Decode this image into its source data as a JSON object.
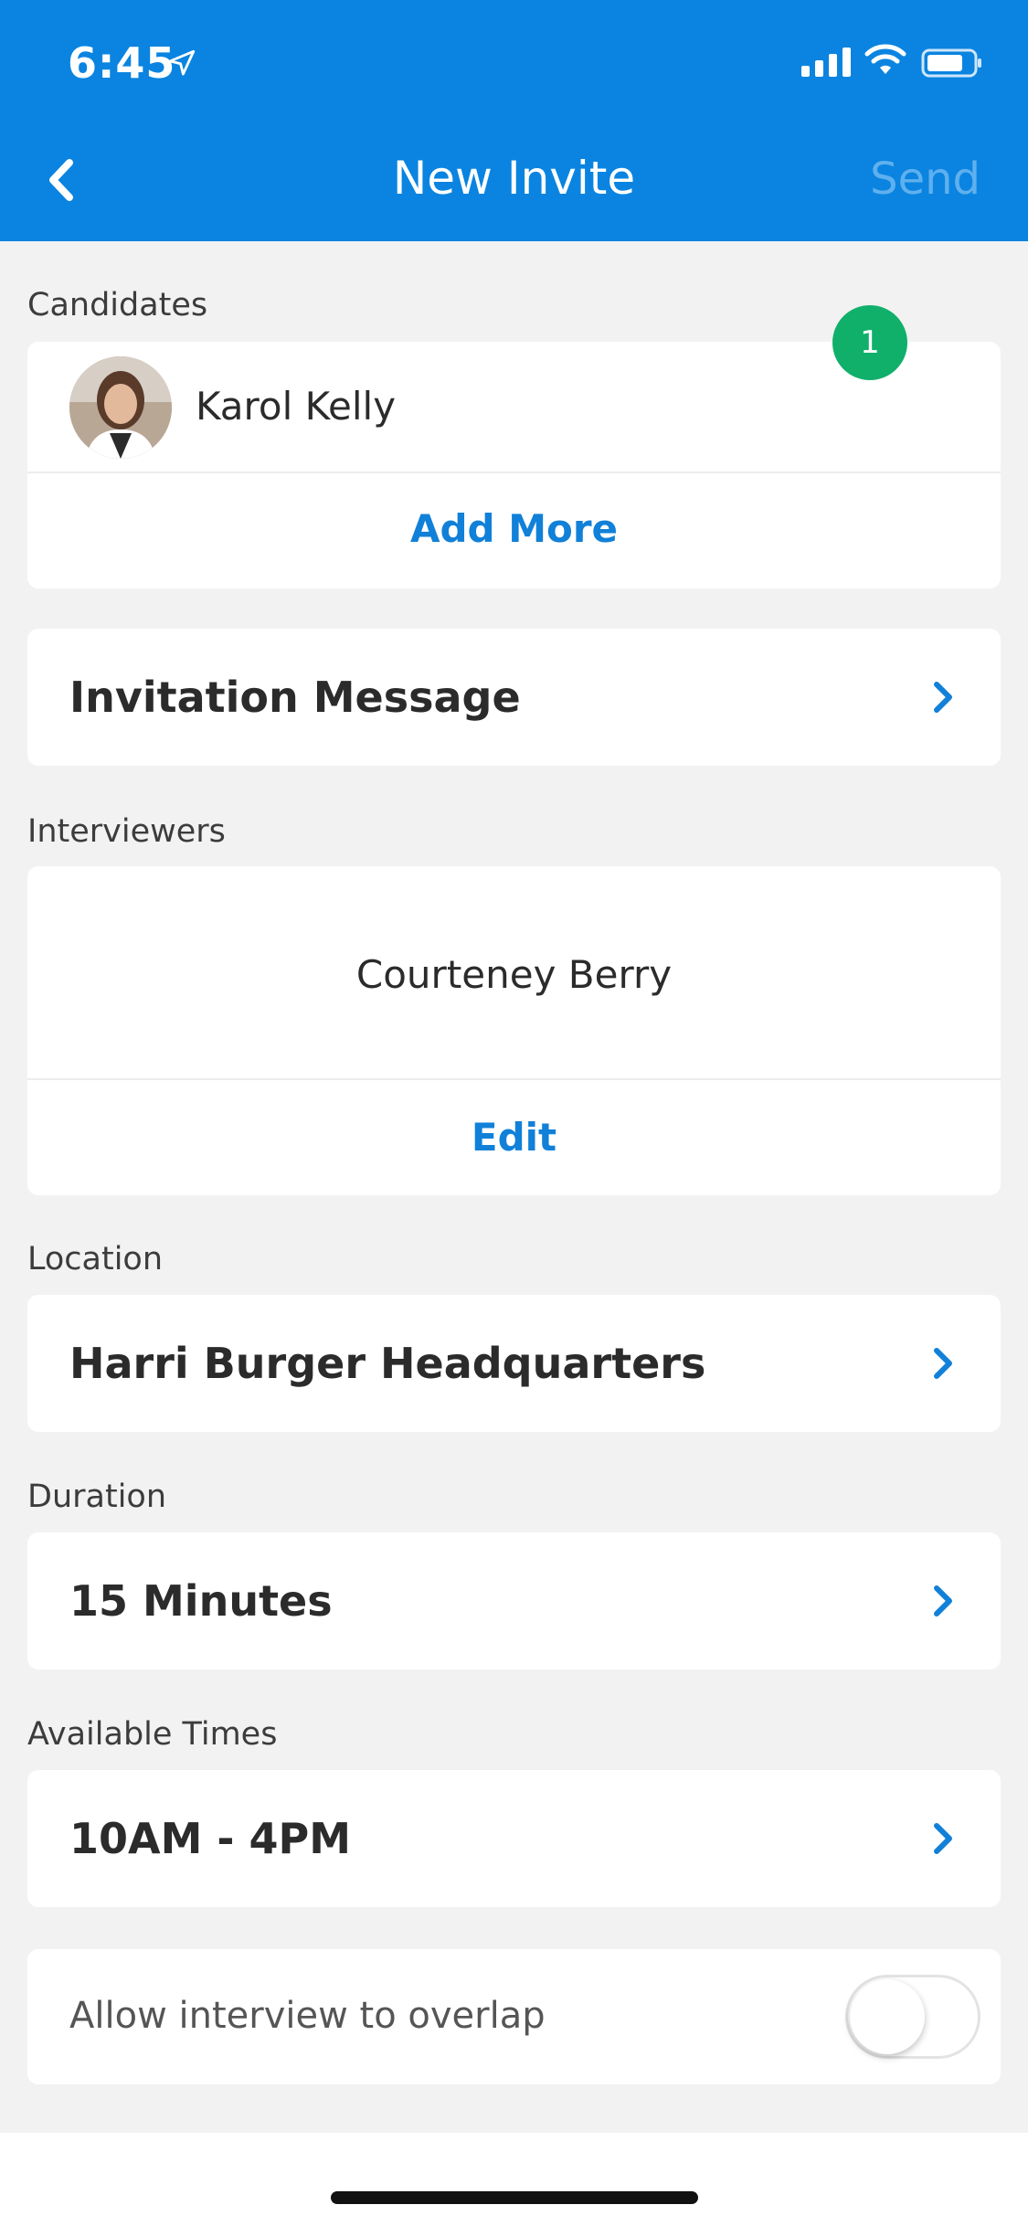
{
  "status_bar": {
    "time": "6:45"
  },
  "nav": {
    "title": "New Invite",
    "send_label": "Send"
  },
  "candidates": {
    "section_label": "Candidates",
    "name": "Karol Kelly",
    "count_badge": "1",
    "add_more_label": "Add More"
  },
  "invitation": {
    "label": "Invitation Message"
  },
  "interviewers": {
    "section_label": "Interviewers",
    "name": "Courteney Berry",
    "edit_label": "Edit"
  },
  "location": {
    "section_label": "Location",
    "value": "Harri Burger Headquarters"
  },
  "duration": {
    "section_label": "Duration",
    "value": "15 Minutes"
  },
  "available_times": {
    "section_label": "Available Times",
    "value": "10AM - 4PM"
  },
  "overlap": {
    "label": "Allow interview to overlap",
    "enabled": false
  },
  "colors": {
    "header": "#0a84e0",
    "accent": "#1180d8",
    "badge": "#10b06a",
    "background": "#f2f2f2"
  },
  "icons": {
    "back": "chevron-left-icon",
    "row": "chevron-right-icon",
    "location_services": "location-arrow-icon",
    "signal": "cellular-signal-icon",
    "wifi": "wifi-icon",
    "battery": "battery-icon"
  }
}
